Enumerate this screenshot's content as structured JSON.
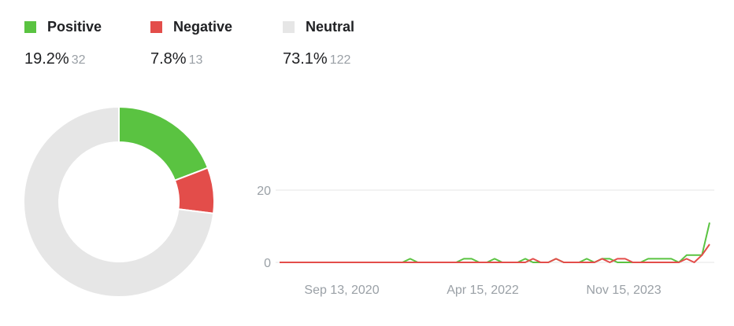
{
  "legend": [
    {
      "label": "Positive",
      "percent": "19.2%",
      "count": "32",
      "color": "#5ac341"
    },
    {
      "label": "Negative",
      "percent": "7.8%",
      "count": "13",
      "color": "#e34d4a"
    },
    {
      "label": "Neutral",
      "percent": "73.1%",
      "count": "122",
      "color": "#e6e6e6"
    }
  ],
  "chart_data": [
    {
      "type": "pie",
      "variant": "donut",
      "slices": [
        {
          "label": "Positive",
          "value": 32,
          "percent": 19.2,
          "color": "#5ac341"
        },
        {
          "label": "Negative",
          "value": 13,
          "percent": 7.8,
          "color": "#e34d4a"
        },
        {
          "label": "Neutral",
          "value": 122,
          "percent": 73.1,
          "color": "#e6e6e6"
        }
      ]
    },
    {
      "type": "line",
      "x_tick_labels": [
        "Sep 13, 2020",
        "Apr 15, 2022",
        "Nov 15, 2023"
      ],
      "y_ticks": [
        0,
        20
      ],
      "ylim": [
        0,
        20
      ],
      "grid": true,
      "series": [
        {
          "name": "Positive",
          "color": "#5ac341",
          "values": [
            0,
            0,
            0,
            0,
            0,
            0,
            0,
            0,
            0,
            0,
            0,
            0,
            0,
            0,
            0,
            0,
            0,
            1,
            0,
            0,
            0,
            0,
            0,
            0,
            1,
            1,
            0,
            0,
            1,
            0,
            0,
            0,
            1,
            0,
            0,
            0,
            1,
            0,
            0,
            0,
            1,
            0,
            1,
            1,
            0,
            0,
            0,
            0,
            1,
            1,
            1,
            1,
            0,
            2,
            2,
            2,
            11
          ]
        },
        {
          "name": "Negative",
          "color": "#e34d4a",
          "values": [
            0,
            0,
            0,
            0,
            0,
            0,
            0,
            0,
            0,
            0,
            0,
            0,
            0,
            0,
            0,
            0,
            0,
            0,
            0,
            0,
            0,
            0,
            0,
            0,
            0,
            0,
            0,
            0,
            0,
            0,
            0,
            0,
            0,
            1,
            0,
            0,
            1,
            0,
            0,
            0,
            0,
            0,
            1,
            0,
            1,
            1,
            0,
            0,
            0,
            0,
            0,
            0,
            0,
            1,
            0,
            2,
            5
          ]
        }
      ]
    }
  ]
}
